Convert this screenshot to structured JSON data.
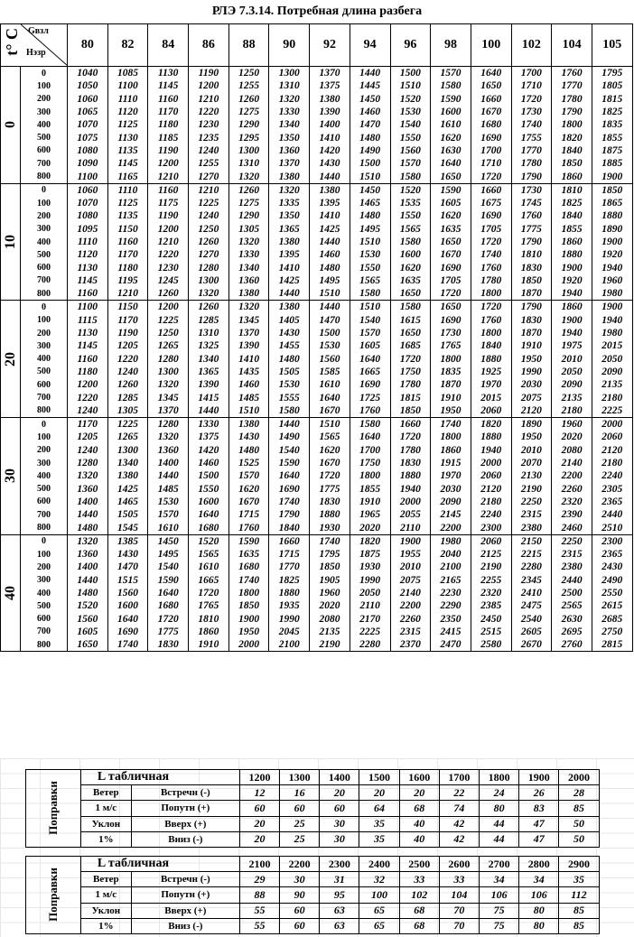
{
  "title": "РЛЭ  7.3.14.  Потребная  длина  разбега",
  "corner": {
    "temp_label": "t° C",
    "weight_label": "Gвзл",
    "alt_label": "Нэзр"
  },
  "weights": [
    "80",
    "82",
    "84",
    "86",
    "88",
    "90",
    "92",
    "94",
    "96",
    "98",
    "100",
    "102",
    "104",
    "105"
  ],
  "groups": [
    {
      "temp": "0",
      "rows": [
        {
          "h": "0",
          "v": [
            "1040",
            "1085",
            "1130",
            "1190",
            "1250",
            "1300",
            "1370",
            "1440",
            "1500",
            "1570",
            "1640",
            "1700",
            "1760",
            "1795"
          ]
        },
        {
          "h": "100",
          "v": [
            "1050",
            "1100",
            "1145",
            "1200",
            "1255",
            "1310",
            "1375",
            "1445",
            "1510",
            "1580",
            "1650",
            "1710",
            "1770",
            "1805"
          ]
        },
        {
          "h": "200",
          "v": [
            "1060",
            "1110",
            "1160",
            "1210",
            "1260",
            "1320",
            "1380",
            "1450",
            "1520",
            "1590",
            "1660",
            "1720",
            "1780",
            "1815"
          ]
        },
        {
          "h": "300",
          "v": [
            "1065",
            "1120",
            "1170",
            "1220",
            "1275",
            "1330",
            "1390",
            "1460",
            "1530",
            "1600",
            "1670",
            "1730",
            "1790",
            "1825"
          ]
        },
        {
          "h": "400",
          "v": [
            "1070",
            "1125",
            "1180",
            "1230",
            "1290",
            "1340",
            "1400",
            "1470",
            "1540",
            "1610",
            "1680",
            "1740",
            "1800",
            "1835"
          ]
        },
        {
          "h": "500",
          "v": [
            "1075",
            "1130",
            "1185",
            "1235",
            "1295",
            "1350",
            "1410",
            "1480",
            "1550",
            "1620",
            "1690",
            "1755",
            "1820",
            "1855"
          ]
        },
        {
          "h": "600",
          "v": [
            "1080",
            "1135",
            "1190",
            "1240",
            "1300",
            "1360",
            "1420",
            "1490",
            "1560",
            "1630",
            "1700",
            "1770",
            "1840",
            "1875"
          ]
        },
        {
          "h": "700",
          "v": [
            "1090",
            "1145",
            "1200",
            "1255",
            "1310",
            "1370",
            "1430",
            "1500",
            "1570",
            "1640",
            "1710",
            "1780",
            "1850",
            "1885"
          ]
        },
        {
          "h": "800",
          "v": [
            "1100",
            "1165",
            "1210",
            "1270",
            "1320",
            "1380",
            "1440",
            "1510",
            "1580",
            "1650",
            "1720",
            "1790",
            "1860",
            "1900"
          ]
        }
      ]
    },
    {
      "temp": "10",
      "rows": [
        {
          "h": "0",
          "v": [
            "1060",
            "1110",
            "1160",
            "1210",
            "1260",
            "1320",
            "1380",
            "1450",
            "1520",
            "1590",
            "1660",
            "1730",
            "1810",
            "1850"
          ]
        },
        {
          "h": "100",
          "v": [
            "1070",
            "1125",
            "1175",
            "1225",
            "1275",
            "1335",
            "1395",
            "1465",
            "1535",
            "1605",
            "1675",
            "1745",
            "1825",
            "1865"
          ]
        },
        {
          "h": "200",
          "v": [
            "1080",
            "1135",
            "1190",
            "1240",
            "1290",
            "1350",
            "1410",
            "1480",
            "1550",
            "1620",
            "1690",
            "1760",
            "1840",
            "1880"
          ]
        },
        {
          "h": "300",
          "v": [
            "1095",
            "1150",
            "1200",
            "1250",
            "1305",
            "1365",
            "1425",
            "1495",
            "1565",
            "1635",
            "1705",
            "1775",
            "1855",
            "1890"
          ]
        },
        {
          "h": "400",
          "v": [
            "1110",
            "1160",
            "1210",
            "1260",
            "1320",
            "1380",
            "1440",
            "1510",
            "1580",
            "1650",
            "1720",
            "1790",
            "1860",
            "1900"
          ]
        },
        {
          "h": "500",
          "v": [
            "1120",
            "1170",
            "1220",
            "1270",
            "1330",
            "1395",
            "1460",
            "1530",
            "1600",
            "1670",
            "1740",
            "1810",
            "1880",
            "1920"
          ]
        },
        {
          "h": "600",
          "v": [
            "1130",
            "1180",
            "1230",
            "1280",
            "1340",
            "1410",
            "1480",
            "1550",
            "1620",
            "1690",
            "1760",
            "1830",
            "1900",
            "1940"
          ]
        },
        {
          "h": "700",
          "v": [
            "1145",
            "1195",
            "1245",
            "1300",
            "1360",
            "1425",
            "1495",
            "1565",
            "1635",
            "1705",
            "1780",
            "1850",
            "1920",
            "1960"
          ]
        },
        {
          "h": "800",
          "v": [
            "1160",
            "1210",
            "1260",
            "1320",
            "1380",
            "1440",
            "1510",
            "1580",
            "1650",
            "1720",
            "1800",
            "1870",
            "1940",
            "1980"
          ]
        }
      ]
    },
    {
      "temp": "20",
      "rows": [
        {
          "h": "0",
          "v": [
            "1100",
            "1150",
            "1200",
            "1260",
            "1320",
            "1380",
            "1440",
            "1510",
            "1580",
            "1650",
            "1720",
            "1790",
            "1860",
            "1900"
          ]
        },
        {
          "h": "100",
          "v": [
            "1115",
            "1170",
            "1225",
            "1285",
            "1345",
            "1405",
            "1470",
            "1540",
            "1615",
            "1690",
            "1760",
            "1830",
            "1900",
            "1940"
          ]
        },
        {
          "h": "200",
          "v": [
            "1130",
            "1190",
            "1250",
            "1310",
            "1370",
            "1430",
            "1500",
            "1570",
            "1650",
            "1730",
            "1800",
            "1870",
            "1940",
            "1980"
          ]
        },
        {
          "h": "300",
          "v": [
            "1145",
            "1205",
            "1265",
            "1325",
            "1390",
            "1455",
            "1530",
            "1605",
            "1685",
            "1765",
            "1840",
            "1910",
            "1975",
            "2015"
          ]
        },
        {
          "h": "400",
          "v": [
            "1160",
            "1220",
            "1280",
            "1340",
            "1410",
            "1480",
            "1560",
            "1640",
            "1720",
            "1800",
            "1880",
            "1950",
            "2010",
            "2050"
          ]
        },
        {
          "h": "500",
          "v": [
            "1180",
            "1240",
            "1300",
            "1365",
            "1435",
            "1505",
            "1585",
            "1665",
            "1750",
            "1835",
            "1925",
            "1990",
            "2050",
            "2090"
          ]
        },
        {
          "h": "600",
          "v": [
            "1200",
            "1260",
            "1320",
            "1390",
            "1460",
            "1530",
            "1610",
            "1690",
            "1780",
            "1870",
            "1970",
            "2030",
            "2090",
            "2135"
          ]
        },
        {
          "h": "700",
          "v": [
            "1220",
            "1285",
            "1345",
            "1415",
            "1485",
            "1555",
            "1640",
            "1725",
            "1815",
            "1910",
            "2015",
            "2075",
            "2135",
            "2180"
          ]
        },
        {
          "h": "800",
          "v": [
            "1240",
            "1305",
            "1370",
            "1440",
            "1510",
            "1580",
            "1670",
            "1760",
            "1850",
            "1950",
            "2060",
            "2120",
            "2180",
            "2225"
          ]
        }
      ]
    },
    {
      "temp": "30",
      "rows": [
        {
          "h": "0",
          "v": [
            "1170",
            "1225",
            "1280",
            "1330",
            "1380",
            "1440",
            "1510",
            "1580",
            "1660",
            "1740",
            "1820",
            "1890",
            "1960",
            "2000"
          ]
        },
        {
          "h": "100",
          "v": [
            "1205",
            "1265",
            "1320",
            "1375",
            "1430",
            "1490",
            "1565",
            "1640",
            "1720",
            "1800",
            "1880",
            "1950",
            "2020",
            "2060"
          ]
        },
        {
          "h": "200",
          "v": [
            "1240",
            "1300",
            "1360",
            "1420",
            "1480",
            "1540",
            "1620",
            "1700",
            "1780",
            "1860",
            "1940",
            "2010",
            "2080",
            "2120"
          ]
        },
        {
          "h": "300",
          "v": [
            "1280",
            "1340",
            "1400",
            "1460",
            "1525",
            "1590",
            "1670",
            "1750",
            "1830",
            "1915",
            "2000",
            "2070",
            "2140",
            "2180"
          ]
        },
        {
          "h": "400",
          "v": [
            "1320",
            "1380",
            "1440",
            "1500",
            "1570",
            "1640",
            "1720",
            "1800",
            "1880",
            "1970",
            "2060",
            "2130",
            "2200",
            "2240"
          ]
        },
        {
          "h": "500",
          "v": [
            "1360",
            "1425",
            "1485",
            "1550",
            "1620",
            "1690",
            "1775",
            "1855",
            "1940",
            "2030",
            "2120",
            "2190",
            "2260",
            "2305"
          ]
        },
        {
          "h": "600",
          "v": [
            "1400",
            "1465",
            "1530",
            "1600",
            "1670",
            "1740",
            "1830",
            "1910",
            "2000",
            "2090",
            "2180",
            "2250",
            "2320",
            "2365"
          ]
        },
        {
          "h": "700",
          "v": [
            "1440",
            "1505",
            "1570",
            "1640",
            "1715",
            "1790",
            "1880",
            "1965",
            "2055",
            "2145",
            "2240",
            "2315",
            "2390",
            "2440"
          ]
        },
        {
          "h": "800",
          "v": [
            "1480",
            "1545",
            "1610",
            "1680",
            "1760",
            "1840",
            "1930",
            "2020",
            "2110",
            "2200",
            "2300",
            "2380",
            "2460",
            "2510"
          ]
        }
      ]
    },
    {
      "temp": "40",
      "rows": [
        {
          "h": "0",
          "v": [
            "1320",
            "1385",
            "1450",
            "1520",
            "1590",
            "1660",
            "1740",
            "1820",
            "1900",
            "1980",
            "2060",
            "2150",
            "2250",
            "2300"
          ]
        },
        {
          "h": "100",
          "v": [
            "1360",
            "1430",
            "1495",
            "1565",
            "1635",
            "1715",
            "1795",
            "1875",
            "1955",
            "2040",
            "2125",
            "2215",
            "2315",
            "2365"
          ]
        },
        {
          "h": "200",
          "v": [
            "1400",
            "1470",
            "1540",
            "1610",
            "1680",
            "1770",
            "1850",
            "1930",
            "2010",
            "2100",
            "2190",
            "2280",
            "2380",
            "2430"
          ]
        },
        {
          "h": "300",
          "v": [
            "1440",
            "1515",
            "1590",
            "1665",
            "1740",
            "1825",
            "1905",
            "1990",
            "2075",
            "2165",
            "2255",
            "2345",
            "2440",
            "2490"
          ]
        },
        {
          "h": "400",
          "v": [
            "1480",
            "1560",
            "1640",
            "1720",
            "1800",
            "1880",
            "1960",
            "2050",
            "2140",
            "2230",
            "2320",
            "2410",
            "2500",
            "2550"
          ]
        },
        {
          "h": "500",
          "v": [
            "1520",
            "1600",
            "1680",
            "1765",
            "1850",
            "1935",
            "2020",
            "2110",
            "2200",
            "2290",
            "2385",
            "2475",
            "2565",
            "2615"
          ]
        },
        {
          "h": "600",
          "v": [
            "1560",
            "1640",
            "1720",
            "1810",
            "1900",
            "1990",
            "2080",
            "2170",
            "2260",
            "2350",
            "2450",
            "2540",
            "2630",
            "2685"
          ]
        },
        {
          "h": "700",
          "v": [
            "1605",
            "1690",
            "1775",
            "1860",
            "1950",
            "2045",
            "2135",
            "2225",
            "2315",
            "2415",
            "2515",
            "2605",
            "2695",
            "2750"
          ]
        },
        {
          "h": "800",
          "v": [
            "1650",
            "1740",
            "1830",
            "1910",
            "2000",
            "2100",
            "2190",
            "2280",
            "2370",
            "2470",
            "2580",
            "2670",
            "2760",
            "2815"
          ]
        }
      ]
    }
  ],
  "corrections": [
    {
      "side_label": "Поправки",
      "l_label": "L  табличная",
      "l_values": [
        "1200",
        "1300",
        "1400",
        "1500",
        "1600",
        "1700",
        "1800",
        "1900",
        "2000"
      ],
      "rows": [
        {
          "a": "Ветер",
          "b": "Встречн (-)",
          "v": [
            "12",
            "16",
            "20",
            "20",
            "20",
            "22",
            "24",
            "26",
            "28"
          ]
        },
        {
          "a": "1 м/с",
          "b": "Попутн (+)",
          "v": [
            "60",
            "60",
            "60",
            "64",
            "68",
            "74",
            "80",
            "83",
            "85"
          ]
        },
        {
          "a": "Уклон",
          "b": "Вверх (+)",
          "v": [
            "20",
            "25",
            "30",
            "35",
            "40",
            "42",
            "44",
            "47",
            "50"
          ]
        },
        {
          "a": "1%",
          "b": "Вниз (-)",
          "v": [
            "20",
            "25",
            "30",
            "35",
            "40",
            "42",
            "44",
            "47",
            "50"
          ]
        }
      ]
    },
    {
      "side_label": "Поправки",
      "l_label": "L  табличная",
      "l_values": [
        "2100",
        "2200",
        "2300",
        "2400",
        "2500",
        "2600",
        "2700",
        "2800",
        "2900"
      ],
      "rows": [
        {
          "a": "Ветер",
          "b": "Встречн (-)",
          "v": [
            "29",
            "30",
            "31",
            "32",
            "33",
            "33",
            "34",
            "34",
            "35"
          ]
        },
        {
          "a": "1 м/с",
          "b": "Попутн (+)",
          "v": [
            "88",
            "90",
            "95",
            "100",
            "102",
            "104",
            "106",
            "106",
            "112"
          ]
        },
        {
          "a": "Уклон",
          "b": "Вверх (+)",
          "v": [
            "55",
            "60",
            "63",
            "65",
            "68",
            "70",
            "75",
            "80",
            "85"
          ]
        },
        {
          "a": "1%",
          "b": "Вниз (-)",
          "v": [
            "55",
            "60",
            "63",
            "65",
            "68",
            "70",
            "75",
            "80",
            "85"
          ]
        }
      ]
    }
  ]
}
